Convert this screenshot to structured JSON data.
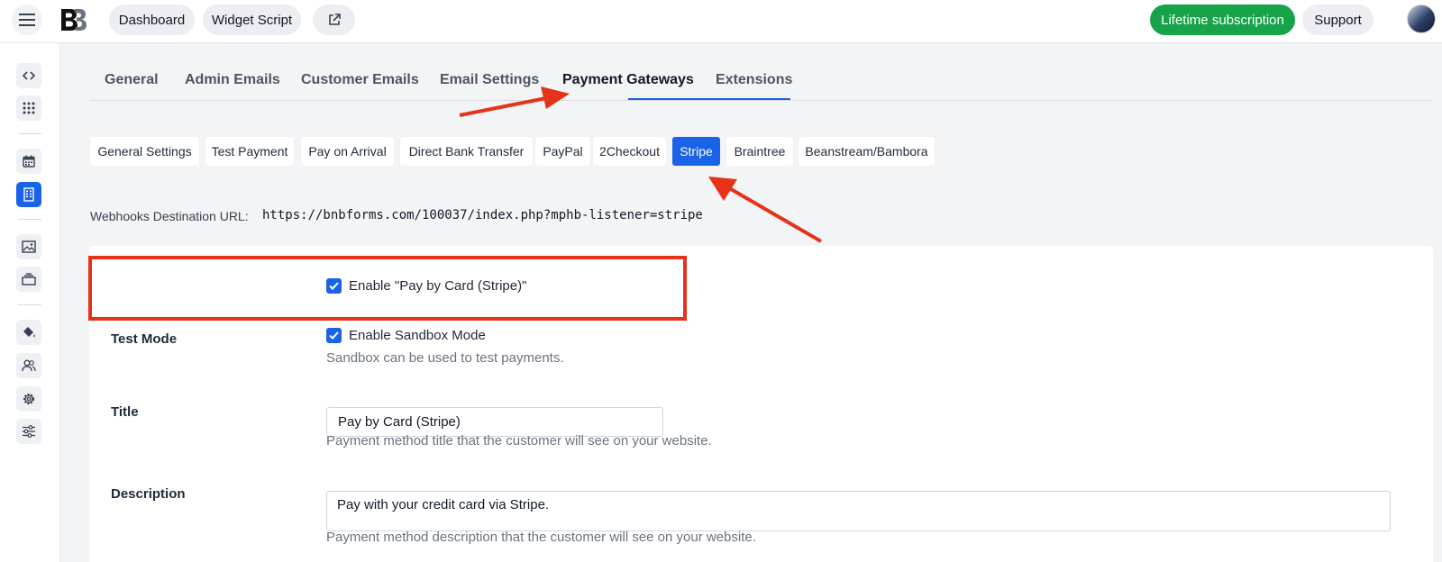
{
  "header": {
    "dashboard_label": "Dashboard",
    "widget_script_label": "Widget Script",
    "subscription_label": "Lifetime subscription",
    "support_label": "Support"
  },
  "colors": {
    "accent": "#1a63e8",
    "green": "#16a34a",
    "annotation_red": "#e53219"
  },
  "sidebar": {
    "items": [
      {
        "icon": "code-icon"
      },
      {
        "icon": "apps-grid-icon"
      },
      {
        "icon": "calendar-icon"
      },
      {
        "icon": "building-icon",
        "active": true
      },
      {
        "icon": "image-icon"
      },
      {
        "icon": "layers-icon"
      },
      {
        "icon": "paint-bucket-icon"
      },
      {
        "icon": "users-icon"
      },
      {
        "icon": "gear-icon"
      },
      {
        "icon": "sliders-icon"
      }
    ]
  },
  "tabs": [
    {
      "label": "General"
    },
    {
      "label": "Admin Emails"
    },
    {
      "label": "Customer Emails"
    },
    {
      "label": "Email Settings"
    },
    {
      "label": "Payment Gateways",
      "active": true
    },
    {
      "label": "Extensions"
    }
  ],
  "subtabs": [
    {
      "label": "General Settings"
    },
    {
      "label": "Test Payment"
    },
    {
      "label": "Pay on Arrival"
    },
    {
      "label": "Direct Bank Transfer"
    },
    {
      "label": "PayPal"
    },
    {
      "label": "2Checkout"
    },
    {
      "label": "Stripe",
      "active": true
    },
    {
      "label": "Braintree"
    },
    {
      "label": "Beanstream/Bambora"
    }
  ],
  "webhook": {
    "label": "Webhooks Destination URL:",
    "url": "https://bnbforms.com/100037/index.php?mphb-listener=stripe"
  },
  "form": {
    "enable_label": "Enable \"Pay by Card (Stripe)\"",
    "enable_checked": true,
    "test_mode_label": "Test Mode",
    "sandbox_label": "Enable Sandbox Mode",
    "sandbox_checked": true,
    "sandbox_help": "Sandbox can be used to test payments.",
    "title_label": "Title",
    "title_value": "Pay by Card (Stripe)",
    "title_help": "Payment method title that the customer will see on your website.",
    "description_label": "Description",
    "description_value": "Pay with your credit card via Stripe.",
    "description_help": "Payment method description that the customer will see on your website."
  }
}
